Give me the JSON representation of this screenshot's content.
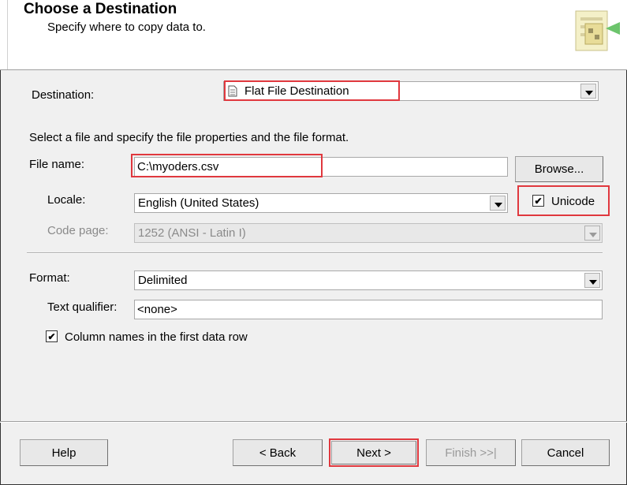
{
  "header": {
    "title": "Choose a Destination",
    "subtitle": "Specify where to copy data to."
  },
  "destination": {
    "label": "Destination:",
    "value": "Flat File Destination"
  },
  "instructions": "Select a file and specify the file properties and the file format.",
  "file_name": {
    "label": "File name:",
    "value": "C:\\myoders.csv",
    "browse_label": "Browse..."
  },
  "locale": {
    "label": "Locale:",
    "value": "English (United States)"
  },
  "unicode": {
    "label": "Unicode",
    "checked": true,
    "check_glyph": "✔"
  },
  "code_page": {
    "label": "Code page:",
    "value": "1252  (ANSI - Latin I)"
  },
  "format": {
    "label": "Format:",
    "value": "Delimited"
  },
  "text_qualifier": {
    "label": "Text qualifier:",
    "value": "<none>"
  },
  "column_names": {
    "label": "Column names in the first data row",
    "checked": true,
    "check_glyph": "✔"
  },
  "buttons": {
    "help": "Help",
    "back": "< Back",
    "next": "Next >",
    "finish": "Finish >>|",
    "cancel": "Cancel"
  },
  "colors": {
    "highlight": "#e0383e"
  }
}
